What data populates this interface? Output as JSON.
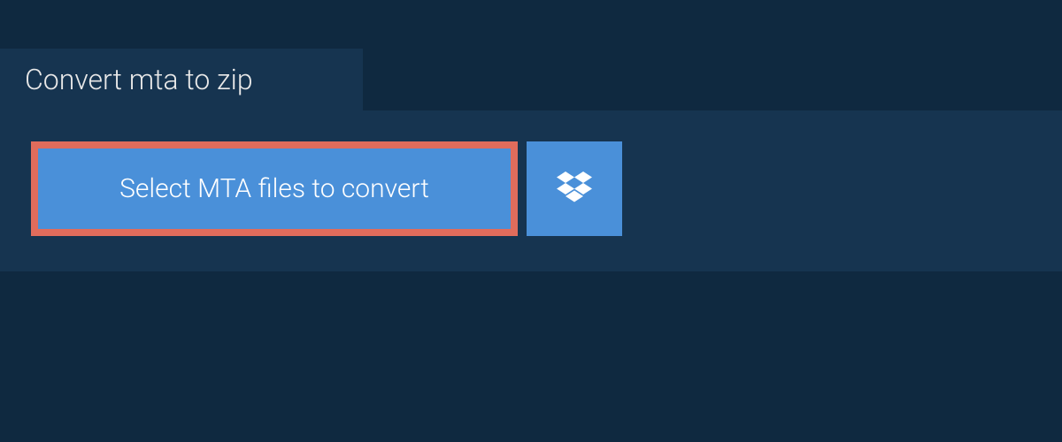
{
  "tab": {
    "title": "Convert mta to zip"
  },
  "actions": {
    "select_label": "Select MTA files to convert"
  }
}
